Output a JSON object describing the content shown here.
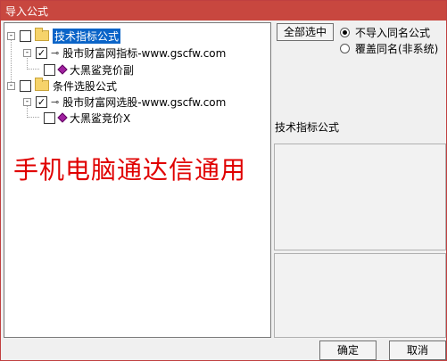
{
  "window": {
    "title": "导入公式"
  },
  "tree": {
    "nodes": [
      {
        "label": "技术指标公式",
        "expander": "-",
        "checked": "",
        "icon": "folder-icon",
        "selected": true
      },
      {
        "label": "股市财富网指标-www.gscfw.com",
        "expander": "-",
        "checked": "✓",
        "icon": "key-icon"
      },
      {
        "label": "大黑鲨竞价副",
        "expander": "",
        "checked": "",
        "icon": "gem-icon"
      },
      {
        "label": "条件选股公式",
        "expander": "-",
        "checked": "",
        "icon": "folder-icon"
      },
      {
        "label": "股市财富网选股-www.gscfw.com",
        "expander": "-",
        "checked": "✓",
        "icon": "key-icon"
      },
      {
        "label": "大黑鲨竞价X",
        "expander": "",
        "checked": "",
        "icon": "gem-icon"
      }
    ]
  },
  "watermark": "手机电脑通达信通用",
  "buttons": {
    "select_all": "全部选中",
    "ok": "确定",
    "cancel": "取消"
  },
  "options": {
    "no_import": "不导入同名公式",
    "overwrite": "覆盖同名(非系统)",
    "selected": "no_import"
  },
  "info_panel": {
    "title": "技术指标公式"
  },
  "colors": {
    "titlebar": "#c8473f",
    "selection": "#0a64c8",
    "watermark": "#e00000",
    "gem": "#a020a0"
  }
}
